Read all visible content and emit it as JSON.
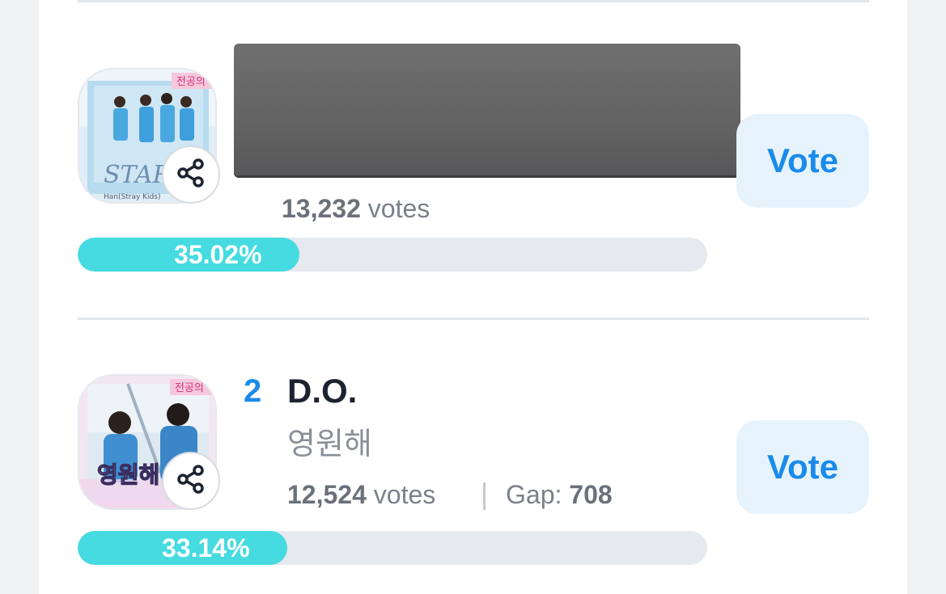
{
  "entries": [
    {
      "rank": "",
      "name": "",
      "song": "",
      "votes_count": "13,232",
      "votes_word": "votes",
      "gap_label": "",
      "gap_value": "",
      "percent": 35.02,
      "percent_text": "35.02%",
      "vote_label": "Vote",
      "thumb_caption": "START",
      "thumb_corner": "전공의",
      "thumb_small": "Han(Stray Kids)"
    },
    {
      "rank": "2",
      "name": "D.O.",
      "song": "영원해",
      "votes_count": "12,524",
      "votes_word": "votes",
      "gap_label": "Gap:",
      "gap_value": "708",
      "percent": 33.14,
      "percent_text": "33.14%",
      "vote_label": "Vote",
      "thumb_caption": "영원해",
      "thumb_corner": "전공의"
    }
  ],
  "colors": {
    "accent": "#1a8bea",
    "bar_fill": "#45dbe0",
    "bar_track": "#e6e9ee",
    "vote_bg": "#e6f3fd"
  },
  "icons": {
    "share": "share-icon"
  }
}
